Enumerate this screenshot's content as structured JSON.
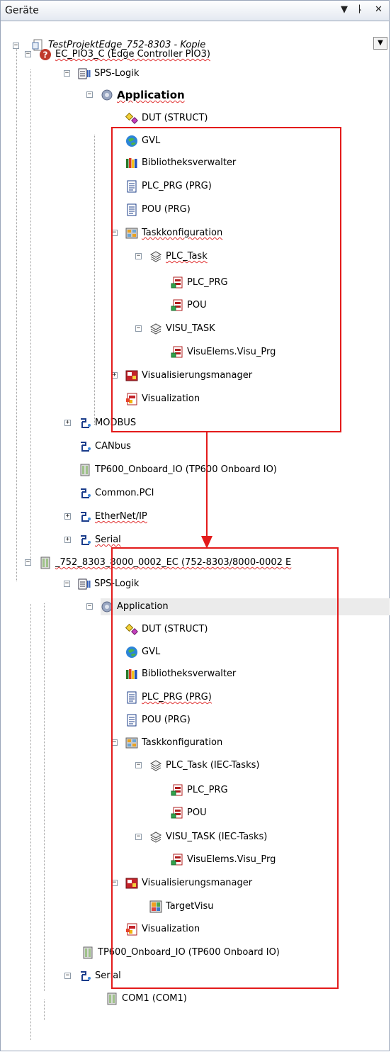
{
  "window": {
    "title": "Geräte"
  },
  "titlebar": {
    "dropdown_glyph": "▼",
    "pin_glyph": "ᚿ",
    "close_glyph": "✕"
  },
  "tree": {
    "project": "TestProjektEdge_752-8303 - Kopie",
    "device1": "EC_PIO3_C (Edge Controller PIO3)",
    "plc1": "SPS-Logik",
    "app1": "Application",
    "a1": {
      "dut": "DUT (STRUCT)",
      "gvl": "GVL",
      "lib": "Bibliotheksverwalter",
      "plcprg": "PLC_PRG (PRG)",
      "pou": "POU (PRG)",
      "task": "Taskkonfiguration",
      "plctask": "PLC_Task",
      "call_plcprg": "PLC_PRG",
      "call_pou": "POU",
      "visutask": "VISU_TASK",
      "call_visu": "VisuElems.Visu_Prg",
      "vismgr": "Visualisierungsmanager",
      "vis": "Visualization"
    },
    "modbus": "MODBUS",
    "canbus": "CANbus",
    "tp600_1": "TP600_Onboard_IO (TP600 Onboard IO)",
    "commonpci": "Common.PCI",
    "ethernetip": "EtherNet/IP",
    "serial1": "Serial",
    "device2": "_752_8303_8000_0002_EC (752-8303/8000-0002 E",
    "plc2": "SPS-Logik",
    "app2": "Application",
    "a2": {
      "dut": "DUT (STRUCT)",
      "gvl": "GVL",
      "lib": "Bibliotheksverwalter",
      "plcprg": "PLC_PRG (PRG)",
      "pou": "POU (PRG)",
      "task": "Taskkonfiguration",
      "plctask": "PLC_Task (IEC-Tasks)",
      "call_plcprg": "PLC_PRG",
      "call_pou": "POU",
      "visutask": "VISU_TASK (IEC-Tasks)",
      "call_visu": "VisuElems.Visu_Prg",
      "vismgr": "Visualisierungsmanager",
      "targetvisu": "TargetVisu",
      "vis": "Visualization"
    },
    "tp600_2": "TP600_Onboard_IO (TP600 Onboard IO)",
    "serial2": "Serial",
    "com1": "COM1 (COM1)"
  },
  "colors": {
    "annotation": "#e31b1b",
    "selection": "#ebebeb",
    "squiggle": "#e03030"
  }
}
